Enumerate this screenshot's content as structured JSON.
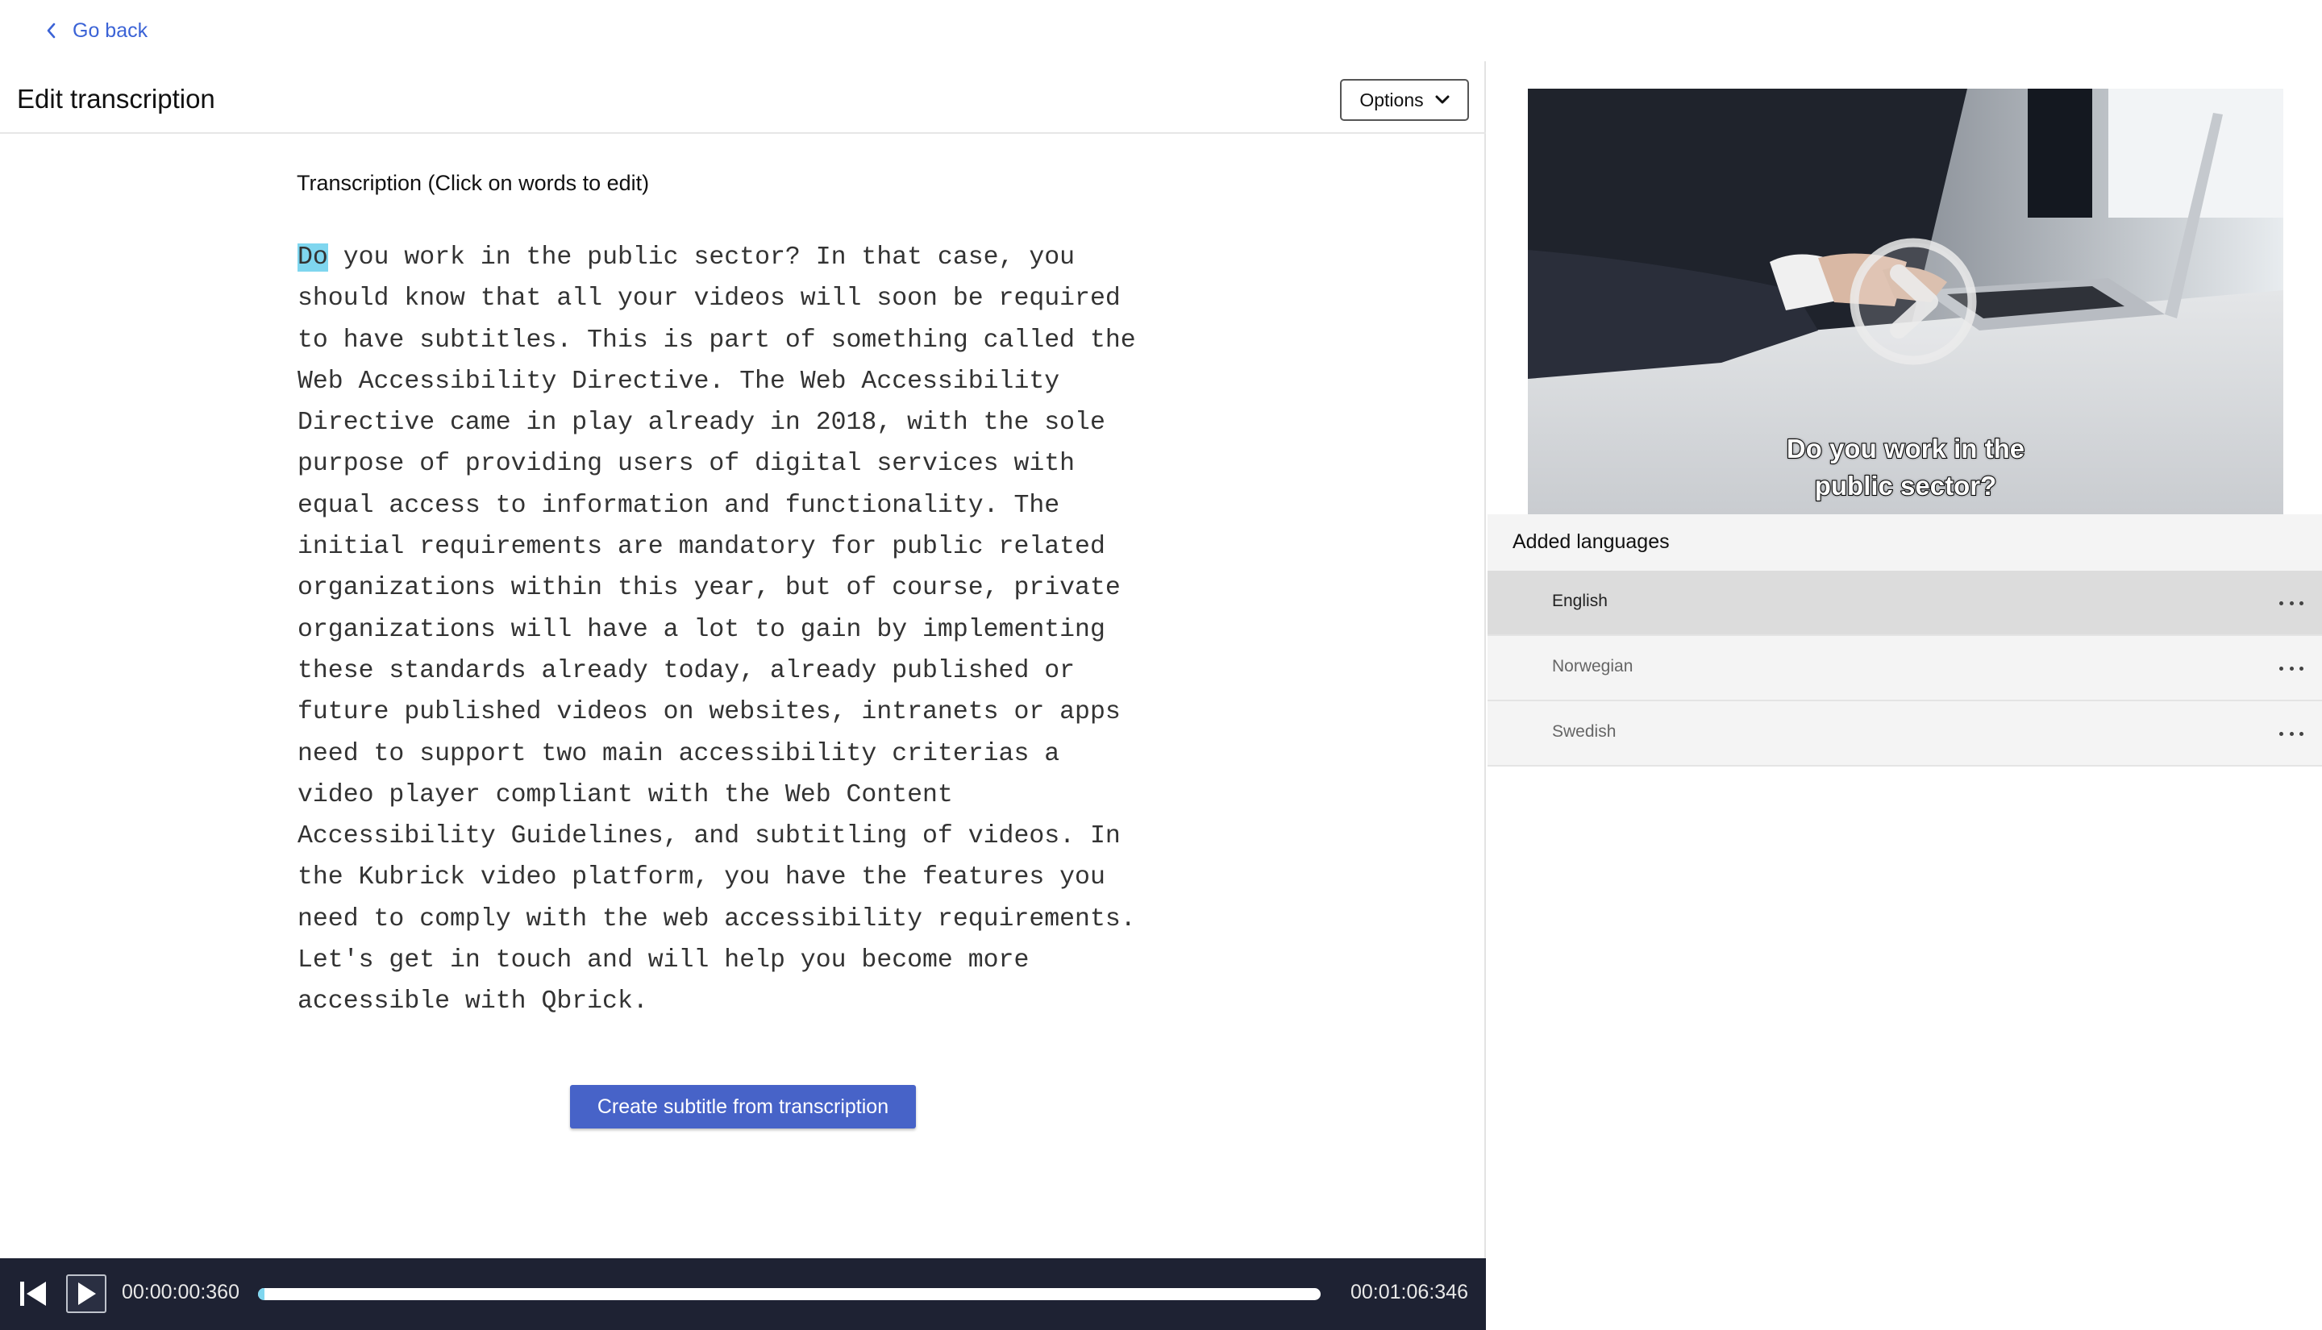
{
  "nav": {
    "go_back": "Go back"
  },
  "header": {
    "title": "Edit transcription",
    "options_label": "Options"
  },
  "transcription": {
    "heading": "Transcription (Click on words to edit)",
    "highlighted_word": "Do",
    "lines": [
      " you work in the public sector? In that case, you",
      "should know that all your videos will soon be required",
      "to have subtitles. This is part of something called the",
      "Web Accessibility Directive. The Web Accessibility",
      "Directive came in play already in 2018, with the sole",
      "purpose of providing users of digital services with",
      "equal access to information and functionality. The",
      "initial requirements are mandatory for public related",
      "organizations within this year, but of course, private",
      "organizations will have a lot to gain by implementing",
      "these standards already today, already published or",
      "future published videos on websites, intranets or apps",
      "need to support two main accessibility criterias a",
      "video player compliant with the Web Content",
      "Accessibility Guidelines, and subtitling of videos. In",
      "the Kubrick video platform, you have the features you",
      "need to comply with the web accessibility requirements.",
      "Let's get in touch and will help you become more",
      "accessible with Qbrick."
    ],
    "create_button": "Create subtitle from transcription"
  },
  "player": {
    "current_time": "00:00:00:360",
    "total_time": "00:01:06:346",
    "progress": 0.0054
  },
  "video": {
    "caption_line1": "Do you work in the",
    "caption_line2": "public sector?"
  },
  "languages": {
    "heading": "Added languages",
    "items": [
      {
        "label": "English",
        "active": true
      },
      {
        "label": "Norwegian",
        "active": false
      },
      {
        "label": "Swedish",
        "active": false
      }
    ]
  },
  "colors": {
    "accent": "#4763c8",
    "link": "#3b63d6",
    "highlight": "#7fd6ef",
    "player_bg": "#1e2233"
  }
}
